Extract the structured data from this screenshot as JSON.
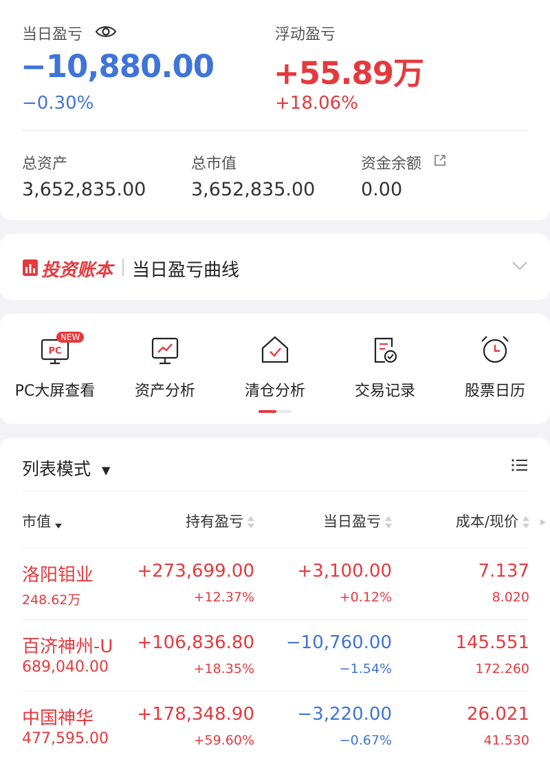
{
  "summary": {
    "daily_pl_label": "当日盈亏",
    "daily_pl_value": "−10,880.00",
    "daily_pl_pct": "−0.30%",
    "float_pl_label": "浮动盈亏",
    "float_pl_value": "+55.89万",
    "float_pl_pct": "+18.06%",
    "total_assets_label": "总资产",
    "total_assets_value": "3,652,835.00",
    "market_value_label": "总市值",
    "market_value_value": "3,652,835.00",
    "cash_label": "资金余额",
    "cash_value": "0.00"
  },
  "ledger": {
    "brand": "投资账本",
    "curve_label": "当日盈亏曲线"
  },
  "features": [
    {
      "label": "PC大屏查看",
      "icon": "pc-screen-icon",
      "badge": "NEW"
    },
    {
      "label": "资产分析",
      "icon": "asset-analysis-icon"
    },
    {
      "label": "清仓分析",
      "icon": "clearance-analysis-icon"
    },
    {
      "label": "交易记录",
      "icon": "trade-record-icon"
    },
    {
      "label": "股票日历",
      "icon": "alarm-clock-icon"
    }
  ],
  "features_page_indicator": {
    "pages": 2,
    "active": 1
  },
  "list": {
    "mode_label": "列表模式",
    "columns": [
      "市值",
      "持有盈亏",
      "当日盈亏",
      "成本/现价"
    ],
    "rows": [
      {
        "name": "洛阳钼业",
        "market_value": "248.62万",
        "hold_pl": "+273,699.00",
        "hold_pl_pct": "+12.37%",
        "day_pl": "+3,100.00",
        "day_pl_pct": "+0.12%",
        "cost": "7.137",
        "price": "8.020",
        "day_dir": "up"
      },
      {
        "name": "百济神州-U",
        "market_value": "689,040.00",
        "hold_pl": "+106,836.80",
        "hold_pl_pct": "+18.35%",
        "day_pl": "−10,760.00",
        "day_pl_pct": "−1.54%",
        "cost": "145.551",
        "price": "172.260",
        "day_dir": "down"
      },
      {
        "name": "中国神华",
        "market_value": "477,595.00",
        "hold_pl": "+178,348.90",
        "hold_pl_pct": "+59.60%",
        "day_pl": "−3,220.00",
        "day_pl_pct": "−0.67%",
        "cost": "26.021",
        "price": "41.530",
        "day_dir": "down"
      }
    ]
  },
  "colors": {
    "up": "#e5393e",
    "down": "#3f74d8",
    "accent": "#e5393e"
  }
}
